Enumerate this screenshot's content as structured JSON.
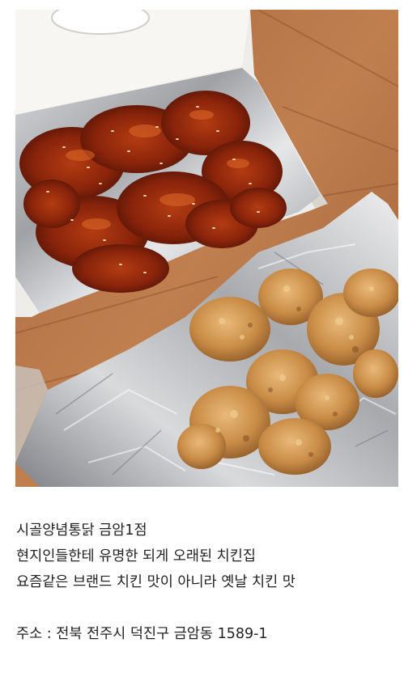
{
  "post": {
    "line1": "시골양념통닭 금암1점",
    "line2": "현지인들한테 유명한 되게 오래된 치킨집",
    "line3": "요즘같은 브랜드 치킨 맛이 아니라 옛날 치킨 맛",
    "address": "주소 : 전북 전주시 덕진구 금암동 1589-1"
  }
}
